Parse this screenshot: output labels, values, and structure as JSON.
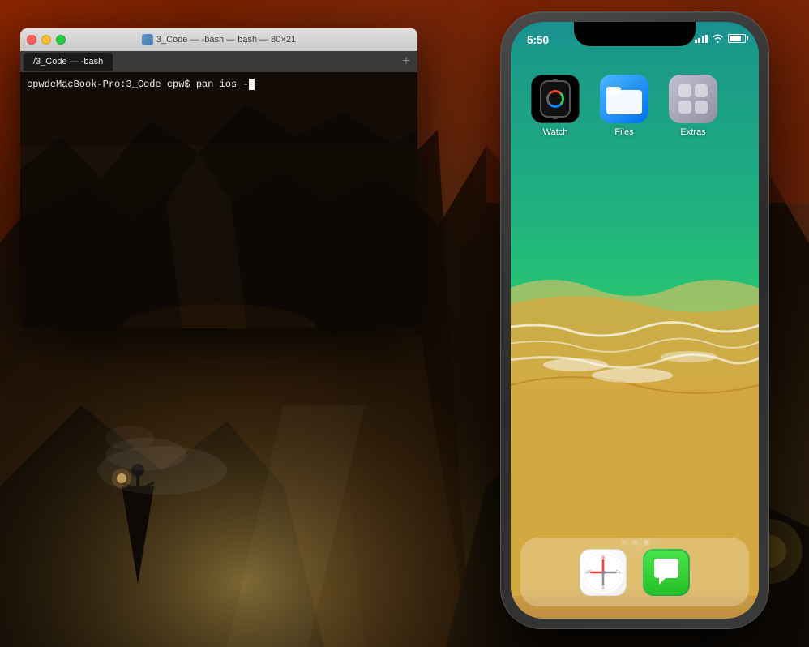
{
  "desktop": {
    "background_desc": "Fantasy mountain landscape desktop background"
  },
  "terminal": {
    "title": "3_Code — -bash — bash — 80×21",
    "title_icon": "folder",
    "tab_label": "/3_Code — -bash",
    "prompt_text": "cpwdeMacBook-Pro:3_Code cpw$ pan ios -",
    "add_tab_label": "+"
  },
  "iphone": {
    "status_bar": {
      "time": "5:50"
    },
    "apps": [
      {
        "id": "watch",
        "label": "Watch",
        "icon_type": "watch"
      },
      {
        "id": "files",
        "label": "Files",
        "icon_type": "files"
      },
      {
        "id": "extras",
        "label": "Extras",
        "icon_type": "extras"
      }
    ],
    "page_dots": [
      {
        "active": false
      },
      {
        "active": false
      },
      {
        "active": true
      }
    ],
    "dock": [
      {
        "id": "safari",
        "label": "Safari",
        "icon_type": "safari"
      },
      {
        "id": "messages",
        "label": "Messages",
        "icon_type": "messages"
      }
    ]
  },
  "traffic_lights": {
    "close": "close",
    "minimize": "minimize",
    "maximize": "maximize"
  }
}
